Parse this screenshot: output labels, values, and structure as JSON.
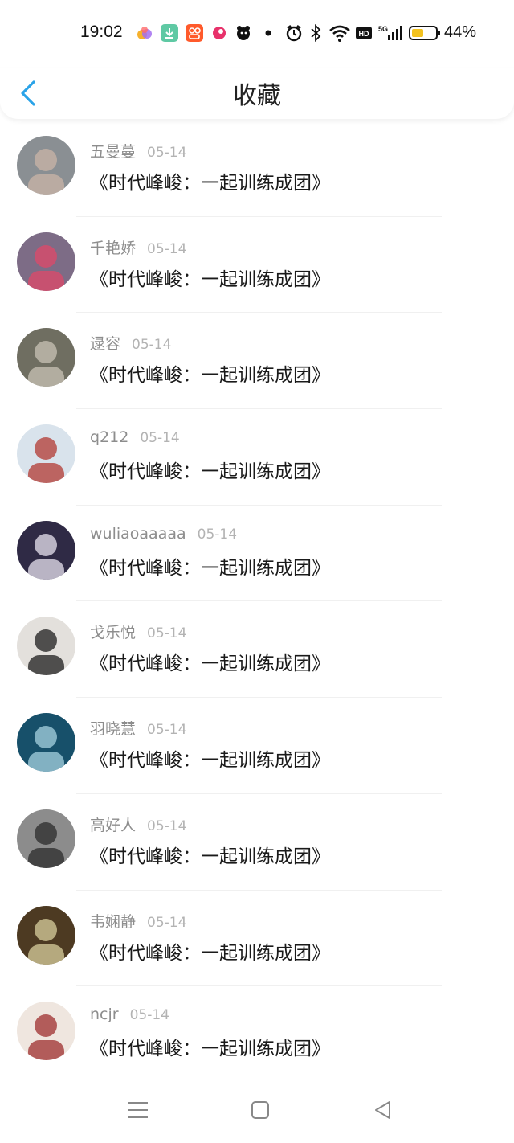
{
  "status": {
    "time": "19:02",
    "battery": "44%"
  },
  "header": {
    "title": "收藏"
  },
  "items": [
    {
      "name": "五曼蔓",
      "date": "05-14",
      "content": "《时代峰峻：一起训练成团》",
      "avatar_color": "#8a8f93",
      "avatar_accent": "#c9b4a7"
    },
    {
      "name": "千艳娇",
      "date": "05-14",
      "content": "《时代峰峻：一起训练成团》",
      "avatar_color": "#7d6c86",
      "avatar_accent": "#e04868"
    },
    {
      "name": "逯容",
      "date": "05-14",
      "content": "《时代峰峻：一起训练成团》",
      "avatar_color": "#6f6e61",
      "avatar_accent": "#c8c3b6"
    },
    {
      "name": "q212",
      "date": "05-14",
      "content": "《时代峰峻：一起训练成团》",
      "avatar_color": "#d9e3ec",
      "avatar_accent": "#b23a33"
    },
    {
      "name": "wuliaoaaaaa",
      "date": "05-14",
      "content": "《时代峰峻：一起训练成团》",
      "avatar_color": "#2f2a45",
      "avatar_accent": "#e8e3ef"
    },
    {
      "name": "戈乐悦",
      "date": "05-14",
      "content": "《时代峰峻：一起训练成团》",
      "avatar_color": "#e3e0dc",
      "avatar_accent": "#1e1e1e"
    },
    {
      "name": "羽晓慧",
      "date": "05-14",
      "content": "《时代峰峻：一起训练成团》",
      "avatar_color": "#17506a",
      "avatar_accent": "#a7d2e0"
    },
    {
      "name": "高好人",
      "date": "05-14",
      "content": "《时代峰峻：一起训练成团》",
      "avatar_color": "#8c8c8c",
      "avatar_accent": "#2b2b2b"
    },
    {
      "name": "韦娴静",
      "date": "05-14",
      "content": "《时代峰峻：一起训练成团》",
      "avatar_color": "#4d3a22",
      "avatar_accent": "#d8cf9e"
    },
    {
      "name": "ncjr",
      "date": "05-14",
      "content": "《时代峰峻：一起训练成团》",
      "avatar_color": "#efe6df",
      "avatar_accent": "#9e2d2d"
    }
  ],
  "icons": {
    "back": "back-arrow-icon",
    "nav": [
      "menu-icon",
      "home-icon",
      "back-icon"
    ]
  },
  "colors": {
    "accent": "#2aa3e8"
  }
}
